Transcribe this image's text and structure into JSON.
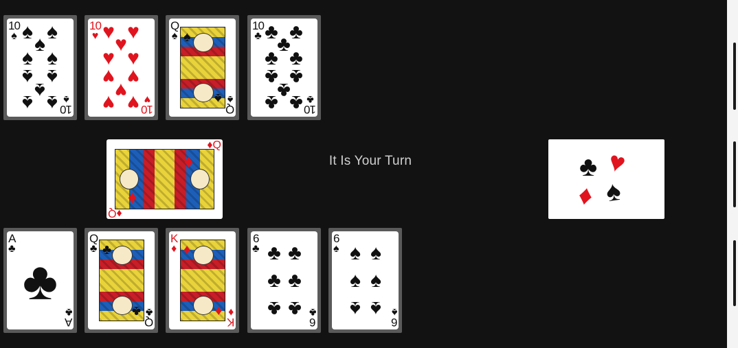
{
  "status_text": "It Is Your Turn",
  "colors": {
    "background": "#121212",
    "red_suit": "#e0141e",
    "black_suit": "#111111",
    "card_slot": "#5a5a5a"
  },
  "opponent_cards": [
    {
      "rank": "10",
      "suit": "spade",
      "suit_symbol": "♠",
      "color": "black"
    },
    {
      "rank": "10",
      "suit": "heart",
      "suit_symbol": "♥",
      "color": "red"
    },
    {
      "rank": "Q",
      "suit": "spade",
      "suit_symbol": "♠",
      "color": "black"
    },
    {
      "rank": "10",
      "suit": "club",
      "suit_symbol": "♣",
      "color": "black"
    }
  ],
  "played_card": {
    "rank": "Q",
    "suit": "diamond",
    "suit_symbol": "♦",
    "color": "red"
  },
  "deck": {
    "symbols": [
      "♣",
      "♥",
      "♦",
      "♠"
    ]
  },
  "player_cards": [
    {
      "rank": "A",
      "suit": "club",
      "suit_symbol": "♣",
      "color": "black"
    },
    {
      "rank": "Q",
      "suit": "club",
      "suit_symbol": "♣",
      "color": "black"
    },
    {
      "rank": "K",
      "suit": "diamond",
      "suit_symbol": "♦",
      "color": "red"
    },
    {
      "rank": "6",
      "suit": "club",
      "suit_symbol": "♣",
      "color": "black"
    },
    {
      "rank": "6",
      "suit": "spade",
      "suit_symbol": "♠",
      "color": "black"
    }
  ]
}
